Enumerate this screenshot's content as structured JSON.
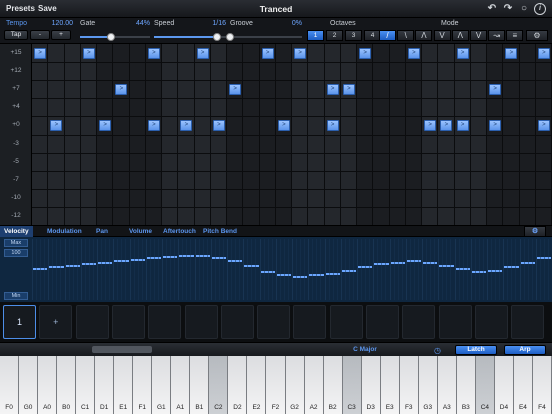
{
  "topbar": {
    "presets_label": "Presets",
    "save_label": "Save",
    "title": "Tranced",
    "icons": [
      "undo-icon",
      "redo-icon",
      "settings-ring-icon",
      "info-icon"
    ]
  },
  "params": {
    "tempo_label": "Tempo",
    "tempo_value": "120.00",
    "tap_label": "Tap",
    "minus_label": "-",
    "plus_label": "+",
    "gate_label": "Gate",
    "gate_value": "44%",
    "gate_level": 0.44,
    "speed_label": "Speed",
    "speed_value": "1/16",
    "speed_level": 0.87,
    "groove_label": "Groove",
    "groove_value": "0%",
    "groove_level": 0.0,
    "octaves_label": "Octaves",
    "octaves": [
      "1",
      "2",
      "3",
      "4"
    ],
    "octave_selected": 0,
    "mode_label": "Mode",
    "modes": [
      "up",
      "down",
      "up-down",
      "down-up",
      "up-down-2",
      "down-up-2",
      "random",
      "order"
    ],
    "mode_selected": 0,
    "mode_glyphs": [
      "/",
      "\\",
      "Λ",
      "V",
      "Λ",
      "V",
      "↝",
      "≡"
    ]
  },
  "grid": {
    "row_labels": [
      "+15",
      "+12",
      "+7",
      "+4",
      "+0",
      "-3",
      "-5",
      "-7",
      "-10",
      "-12"
    ],
    "steps": 32,
    "note_glyph": ">",
    "notes": [
      {
        "step": 0,
        "row": 0
      },
      {
        "step": 3,
        "row": 0
      },
      {
        "step": 5,
        "row": 2
      },
      {
        "step": 7,
        "row": 0
      },
      {
        "step": 10,
        "row": 0
      },
      {
        "step": 12,
        "row": 2
      },
      {
        "step": 14,
        "row": 0
      },
      {
        "step": 16,
        "row": 0
      },
      {
        "step": 18,
        "row": 2
      },
      {
        "step": 19,
        "row": 2
      },
      {
        "step": 20,
        "row": 0
      },
      {
        "step": 23,
        "row": 0
      },
      {
        "step": 26,
        "row": 0
      },
      {
        "step": 28,
        "row": 2
      },
      {
        "step": 29,
        "row": 0
      },
      {
        "step": 31,
        "row": 0
      },
      {
        "step": 1,
        "row": 4
      },
      {
        "step": 4,
        "row": 4
      },
      {
        "step": 7,
        "row": 4
      },
      {
        "step": 9,
        "row": 4
      },
      {
        "step": 11,
        "row": 4
      },
      {
        "step": 15,
        "row": 4
      },
      {
        "step": 18,
        "row": 4
      },
      {
        "step": 24,
        "row": 4
      },
      {
        "step": 25,
        "row": 4
      },
      {
        "step": 26,
        "row": 4
      },
      {
        "step": 28,
        "row": 4
      },
      {
        "step": 31,
        "row": 4
      }
    ]
  },
  "tabs": {
    "items": [
      "Velocity",
      "Modulation",
      "Pan",
      "Volume",
      "Aftertouch",
      "Pitch Bend"
    ],
    "selected": 0
  },
  "velocity": {
    "max_label": "Max",
    "value_label": "100",
    "min_label": "Min",
    "values": [
      0.52,
      0.55,
      0.58,
      0.6,
      0.63,
      0.65,
      0.68,
      0.7,
      0.72,
      0.74,
      0.73,
      0.7,
      0.65,
      0.58,
      0.48,
      0.42,
      0.4,
      0.42,
      0.45,
      0.5,
      0.55,
      0.6,
      0.63,
      0.66,
      0.63,
      0.58,
      0.52,
      0.48,
      0.5,
      0.56,
      0.62,
      0.7
    ]
  },
  "pads": {
    "items": [
      "1",
      "+"
    ],
    "count": 15,
    "selected": 0
  },
  "kbbar": {
    "scale_label": "C Major",
    "latch_label": "Latch",
    "arp_label": "Arp"
  },
  "keyboard": {
    "keys": [
      "F0",
      "G0",
      "A0",
      "B0",
      "C1",
      "D1",
      "E1",
      "F1",
      "G1",
      "A1",
      "B1",
      "C2",
      "D2",
      "E2",
      "F2",
      "G2",
      "A2",
      "B2",
      "C3",
      "D3",
      "E3",
      "F3",
      "G3",
      "A3",
      "B3",
      "C4",
      "D4",
      "E4",
      "F4"
    ],
    "active": [
      "C2",
      "C3",
      "C4"
    ]
  }
}
